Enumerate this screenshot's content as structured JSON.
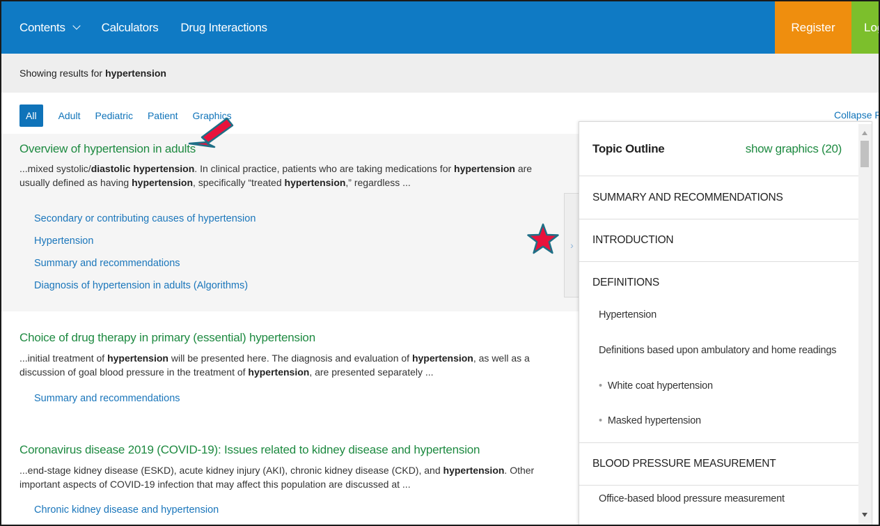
{
  "nav": {
    "contents_label": "Contents",
    "calculators_label": "Calculators",
    "drug_interactions_label": "Drug Interactions",
    "register_label": "Register",
    "login_label": "Log"
  },
  "search": {
    "showing_prefix": "Showing results for",
    "query": "hypertension"
  },
  "filters": {
    "tabs": [
      "All",
      "Adult",
      "Pediatric",
      "Patient",
      "Graphics"
    ],
    "active": "All",
    "collapse_label": "Collapse Re"
  },
  "results": [
    {
      "title": "Overview of hypertension in adults",
      "snippet_parts": [
        {
          "t": "...mixed systolic/",
          "b": false
        },
        {
          "t": "diastolic hypertension",
          "b": true
        },
        {
          "t": ". In clinical practice, patients who are taking medications for ",
          "b": false
        },
        {
          "t": "hypertension",
          "b": true
        },
        {
          "t": " are usually defined as having ",
          "b": false
        },
        {
          "t": "hypertension",
          "b": true
        },
        {
          "t": ", specifically “treated ",
          "b": false
        },
        {
          "t": "hypertension",
          "b": true
        },
        {
          "t": ",” regardless ...",
          "b": false
        }
      ],
      "links": [
        "Secondary or contributing causes of hypertension",
        "Hypertension",
        "Summary and recommendations",
        "Diagnosis of hypertension in adults (Algorithms)"
      ]
    },
    {
      "title": "Choice of drug therapy in primary (essential) hypertension",
      "snippet_parts": [
        {
          "t": "...initial treatment of ",
          "b": false
        },
        {
          "t": "hypertension",
          "b": true
        },
        {
          "t": " will be presented here. The diagnosis and evaluation of ",
          "b": false
        },
        {
          "t": "hypertension",
          "b": true
        },
        {
          "t": ", as well as a discussion of goal blood pressure in the treatment of ",
          "b": false
        },
        {
          "t": "hypertension",
          "b": true
        },
        {
          "t": ", are presented separately ...",
          "b": false
        }
      ],
      "links": [
        "Summary and recommendations"
      ]
    },
    {
      "title": "Coronavirus disease 2019 (COVID-19): Issues related to kidney disease and hypertension",
      "snippet_parts": [
        {
          "t": "...end-stage kidney disease (ESKD), acute kidney injury (AKI), chronic kidney disease (CKD), and ",
          "b": false
        },
        {
          "t": "hypertension",
          "b": true
        },
        {
          "t": ". Other important aspects of COVID-19 infection that may affect this population are discussed at ...",
          "b": false
        }
      ],
      "links": [
        "Chronic kidney disease and hypertension"
      ]
    }
  ],
  "outline": {
    "title": "Topic Outline",
    "show_graphics": "show graphics (20)",
    "sections": [
      "SUMMARY AND RECOMMENDATIONS",
      "INTRODUCTION",
      "DEFINITIONS",
      "BLOOD PRESSURE MEASUREMENT"
    ],
    "definitions_items": [
      "Hypertension",
      "Definitions based upon ambulatory and home readings",
      "White coat hypertension",
      "Masked hypertension"
    ],
    "bp_items": [
      "Office-based blood pressure measurement"
    ]
  },
  "icons": {
    "contents_chevron": "chevron-down-icon",
    "handle": "chevron-right-icon",
    "annotation_arrow": "red-arrow-icon",
    "annotation_star": "red-star-icon"
  },
  "colors": {
    "nav_bg": "#0f7ac4",
    "register_bg": "#ef8e0e",
    "login_bg": "#7cbf2c",
    "title_green": "#1e8a41",
    "link_blue": "#1a76bb",
    "annotation_red": "#e8123c",
    "annotation_outline": "#1e6f86"
  }
}
